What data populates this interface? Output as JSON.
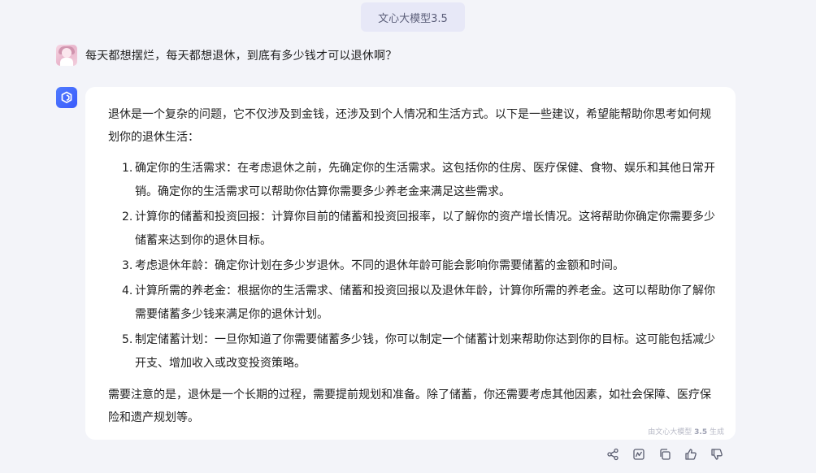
{
  "header": {
    "model_label": "文心大模型3.5"
  },
  "user_message": {
    "text": "每天都想摆烂，每天都想退休，到底有多少钱才可以退休啊？"
  },
  "assistant_message": {
    "intro": "退休是一个复杂的问题，它不仅涉及到金钱，还涉及到个人情况和生活方式。以下是一些建议，希望能帮助你思考如何规划你的退休生活：",
    "items": [
      {
        "num": "1.",
        "text": "确定你的生活需求：在考虑退休之前，先确定你的生活需求。这包括你的住房、医疗保健、食物、娱乐和其他日常开销。确定你的生活需求可以帮助你估算你需要多少养老金来满足这些需求。"
      },
      {
        "num": "2.",
        "text": "计算你的储蓄和投资回报：计算你目前的储蓄和投资回报率，以了解你的资产增长情况。这将帮助你确定你需要多少储蓄来达到你的退休目标。"
      },
      {
        "num": "3.",
        "text": "考虑退休年龄：确定你计划在多少岁退休。不同的退休年龄可能会影响你需要储蓄的金额和时间。"
      },
      {
        "num": "4.",
        "text": "计算所需的养老金：根据你的生活需求、储蓄和投资回报以及退休年龄，计算你所需的养老金。这可以帮助你了解你需要储蓄多少钱来满足你的退休计划。"
      },
      {
        "num": "5.",
        "text": "制定储蓄计划：一旦你知道了你需要储蓄多少钱，你可以制定一个储蓄计划来帮助你达到你的目标。这可能包括减少开支、增加收入或改变投资策略。"
      }
    ],
    "outro": "需要注意的是，退休是一个长期的过程，需要提前规划和准备。除了储蓄，你还需要考虑其他因素，如社会保障、医疗保险和遗产规划等。",
    "generated_by_prefix": "由文心大模型",
    "generated_by_version": "3.5",
    "generated_by_suffix": "生成"
  },
  "actions": {
    "icons": [
      "share-icon",
      "chart-icon",
      "copy-icon",
      "thumbs-up-icon",
      "thumbs-down-icon"
    ]
  },
  "colors": {
    "accent": "#3b5bfb",
    "page_bg": "#f3f4f9",
    "card_bg": "#ffffff",
    "pill_bg": "#e7e8f7"
  }
}
